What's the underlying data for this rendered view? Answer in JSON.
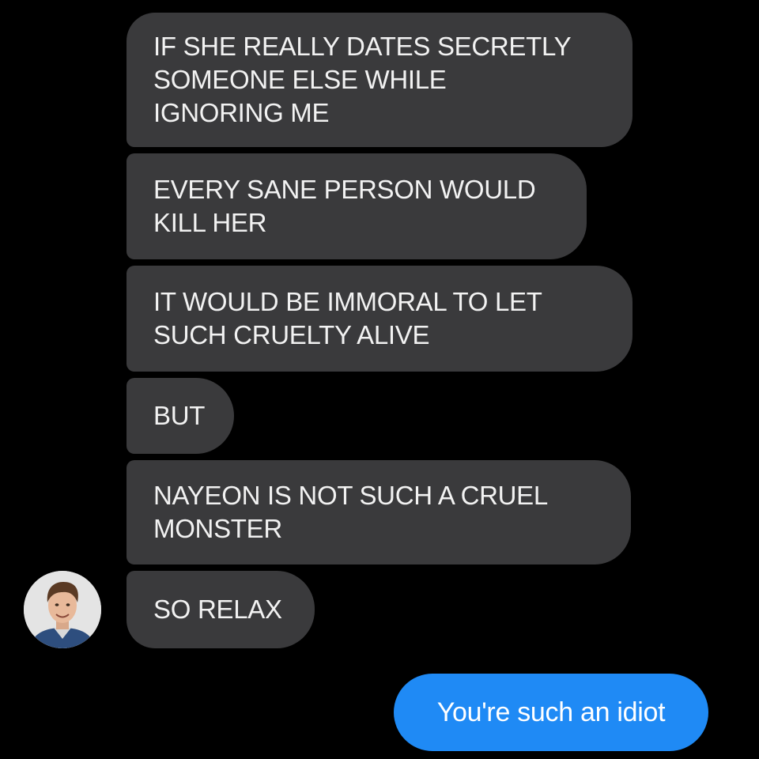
{
  "conversation": {
    "incoming": [
      {
        "lines": [
          "IF SHE REALLY DATES SECRETLY",
          "SOMEONE ELSE WHILE",
          "IGNORING ME"
        ]
      },
      {
        "lines": [
          "EVERY SANE PERSON WOULD",
          "KILL HER"
        ]
      },
      {
        "lines": [
          "IT WOULD BE IMMORAL TO LET",
          "SUCH CRUELTY ALIVE"
        ]
      },
      {
        "lines": [
          "BUT"
        ]
      },
      {
        "lines": [
          "NAYEON IS NOT SUCH A CRUEL",
          "MONSTER"
        ]
      },
      {
        "lines": [
          "SO RELAX"
        ]
      }
    ],
    "outgoing": [
      {
        "text": "You're such an idiot"
      }
    ]
  },
  "colors": {
    "background": "#000000",
    "incoming_bubble": "#3a3a3c",
    "incoming_text": "#f2f2f2",
    "outgoing_bubble": "#1f8af5",
    "outgoing_text": "#ffffff"
  },
  "avatar": {
    "icon": "contact-avatar-photo"
  }
}
